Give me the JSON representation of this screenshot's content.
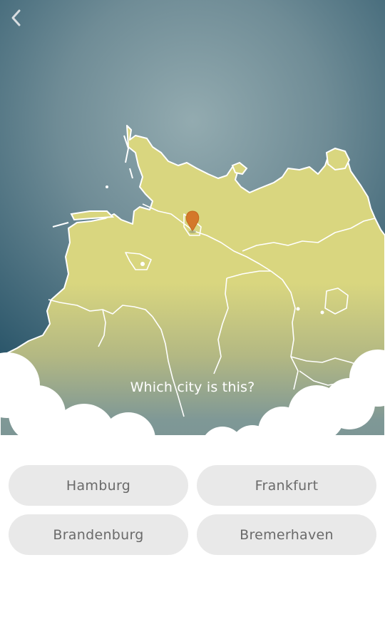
{
  "question": "Which city is this?",
  "answers": [
    {
      "label": "Hamburg"
    },
    {
      "label": "Frankfurt"
    },
    {
      "label": "Brandenburg"
    },
    {
      "label": "Bremerhaven"
    }
  ],
  "colors": {
    "sky_dark": "#2f5a6e",
    "sky_light": "#8fa8ad",
    "land": "#d9d67f",
    "land_fade": "#7f9896",
    "border": "#ffffff",
    "marker": "#d4782a",
    "button_bg": "#e9e9e9",
    "button_text": "#6a6a6a"
  },
  "icons": {
    "back": "chevron-left-icon",
    "marker": "map-pin-icon"
  }
}
